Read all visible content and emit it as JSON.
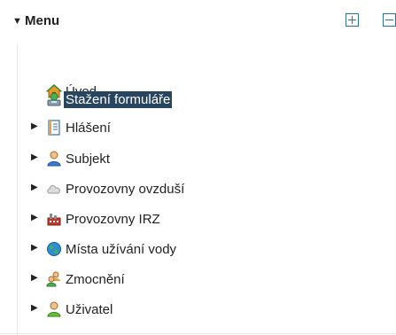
{
  "header": {
    "title": "Menu",
    "expand_all_icon": "plus-box-icon",
    "collapse_all_icon": "minus-box-icon"
  },
  "menu": {
    "items": [
      {
        "label": "Úvod",
        "icon": "home-icon",
        "selected": false,
        "expandable": false
      },
      {
        "label": "Stažení formuláře",
        "icon": "download-form-icon",
        "selected": true,
        "expandable": false
      },
      {
        "label": "Hlášení",
        "icon": "report-icon",
        "selected": false,
        "expandable": true
      },
      {
        "label": "Subjekt",
        "icon": "person-icon",
        "selected": false,
        "expandable": true
      },
      {
        "label": "Provozovny ovzduší",
        "icon": "cloud-icon",
        "selected": false,
        "expandable": true
      },
      {
        "label": "Provozovny IRZ",
        "icon": "factory-icon",
        "selected": false,
        "expandable": true
      },
      {
        "label": "Místa užívání vody",
        "icon": "globe-icon",
        "selected": false,
        "expandable": true
      },
      {
        "label": "Zmocnění",
        "icon": "users-icon",
        "selected": false,
        "expandable": true
      },
      {
        "label": "Uživatel",
        "icon": "user-green-icon",
        "selected": false,
        "expandable": true
      }
    ]
  },
  "colors": {
    "selection_bg": "#27455f",
    "selection_text": "#ffffff",
    "button_border": "#2f6f8f"
  }
}
